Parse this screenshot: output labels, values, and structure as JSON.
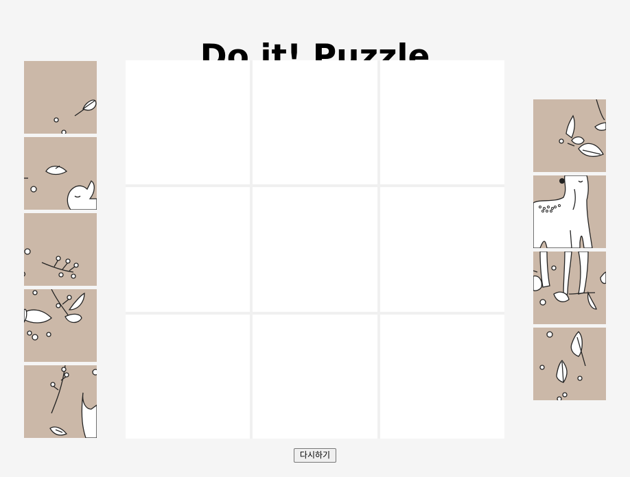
{
  "title": "Do it! Puzzle",
  "board": {
    "rows": 3,
    "cols": 3,
    "cells": [
      "",
      "",
      "",
      "",
      "",
      "",
      "",
      "",
      ""
    ]
  },
  "left_pieces": [
    "puzzle-piece",
    "puzzle-piece",
    "puzzle-piece",
    "puzzle-piece",
    "puzzle-piece"
  ],
  "right_pieces": [
    "puzzle-piece",
    "puzzle-piece",
    "puzzle-piece",
    "puzzle-piece"
  ],
  "restart_button": {
    "label": "다시하기"
  },
  "colors": {
    "background": "#f5f5f5",
    "piece_background": "#cbb8a8",
    "cell": "#ffffff"
  }
}
